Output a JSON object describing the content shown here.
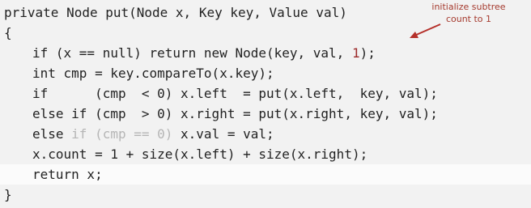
{
  "code": {
    "lines": [
      "private Node put(Node x, Key key, Value val)",
      "{",
      "if (x == null) return new Node(key, val, ",
      "1",
      ");",
      "int cmp = key.compareTo(x.key);",
      "if      (cmp  < 0) x.left  = put(x.left,  key, val);",
      "else if (cmp  > 0) x.right = put(x.right, key, val);",
      "else ",
      "if (cmp == 0) ",
      "x.val = val;",
      "x.count = 1 + size(x.left) + size(x.right);",
      "return x;",
      "}"
    ]
  },
  "annotation": {
    "line1": "initialize subtree",
    "line2": "count to 1"
  },
  "colors": {
    "code_text": "#222222",
    "accent_red": "#9b2a2a",
    "muted_gray": "#b5b5b5",
    "background": "#f2f2f2",
    "highlight": "#fbfbfb"
  }
}
